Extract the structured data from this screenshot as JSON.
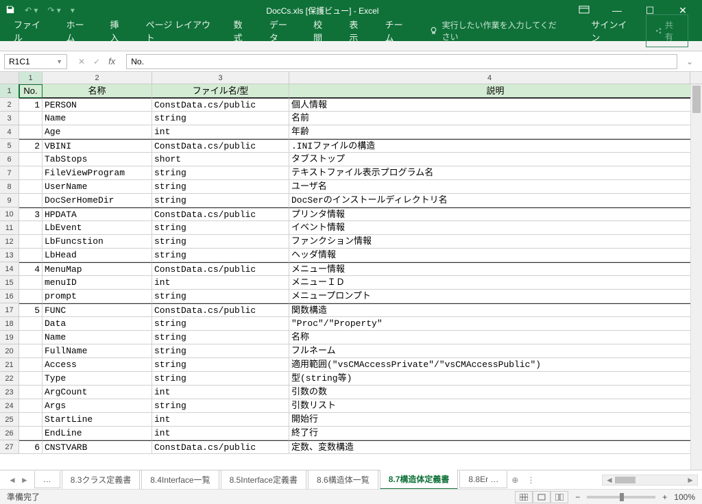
{
  "title": "DocCs.xls  [保護ビュー] - Excel",
  "qat": {
    "save": "save-icon",
    "undo": "undo-icon",
    "redo": "redo-icon"
  },
  "ribbon": {
    "tabs": [
      "ファイル",
      "ホーム",
      "挿入",
      "ページ レイアウト",
      "数式",
      "データ",
      "校閲",
      "表示",
      "チーム"
    ],
    "tellme": "実行したい作業を入力してください",
    "signin": "サインイン",
    "share": "共有"
  },
  "namebox": "R1C1",
  "formula": "No.",
  "colnums": [
    "1",
    "2",
    "3",
    "4"
  ],
  "headers": {
    "c1": "No.",
    "c2": "名称",
    "c3": "ファイル名/型",
    "c4": "説明"
  },
  "rows": [
    {
      "n": "1",
      "no": "1",
      "name": "PERSON",
      "type": "ConstData.cs/public",
      "desc": "個人情報"
    },
    {
      "n": "2",
      "no": "",
      "name": "Name",
      "type": "string",
      "desc": "名前"
    },
    {
      "n": "3",
      "no": "",
      "name": "Age",
      "type": "int",
      "desc": "年齢"
    },
    {
      "n": "4",
      "no": "2",
      "name": "VBINI",
      "type": "ConstData.cs/public",
      "desc": ".INIファイルの構造"
    },
    {
      "n": "5",
      "no": "",
      "name": "TabStops",
      "type": "short",
      "desc": "タブストップ"
    },
    {
      "n": "6",
      "no": "",
      "name": "FileViewProgram",
      "type": "string",
      "desc": "テキストファイル表示プログラム名"
    },
    {
      "n": "7",
      "no": "",
      "name": "UserName",
      "type": "string",
      "desc": "ユーザ名"
    },
    {
      "n": "8",
      "no": "",
      "name": "DocSerHomeDir",
      "type": "string",
      "desc": "DocSerのインストールディレクトリ名"
    },
    {
      "n": "9",
      "no": "3",
      "name": "HPDATA",
      "type": "ConstData.cs/public",
      "desc": "プリンタ情報"
    },
    {
      "n": "10",
      "no": "",
      "name": "LbEvent",
      "type": "string",
      "desc": "イベント情報"
    },
    {
      "n": "11",
      "no": "",
      "name": "LbFuncstion",
      "type": "string",
      "desc": "ファンクション情報"
    },
    {
      "n": "12",
      "no": "",
      "name": "LbHead",
      "type": "string",
      "desc": "ヘッダ情報"
    },
    {
      "n": "13",
      "no": "4",
      "name": "MenuMap",
      "type": "ConstData.cs/public",
      "desc": "メニュー情報"
    },
    {
      "n": "14",
      "no": "",
      "name": "menuID",
      "type": "int",
      "desc": "メニューＩＤ"
    },
    {
      "n": "15",
      "no": "",
      "name": "prompt",
      "type": "string",
      "desc": "メニュープロンプト"
    },
    {
      "n": "16",
      "no": "5",
      "name": "FUNC",
      "type": "ConstData.cs/public",
      "desc": "関数構造"
    },
    {
      "n": "17",
      "no": "",
      "name": "Data",
      "type": "string",
      "desc": "\"Proc\"/\"Property\""
    },
    {
      "n": "18",
      "no": "",
      "name": "Name",
      "type": "string",
      "desc": "名称"
    },
    {
      "n": "19",
      "no": "",
      "name": "FullName",
      "type": "string",
      "desc": "フルネーム"
    },
    {
      "n": "20",
      "no": "",
      "name": "Access",
      "type": "string",
      "desc": "適用範囲(\"vsCMAccessPrivate\"/\"vsCMAccessPublic\")"
    },
    {
      "n": "21",
      "no": "",
      "name": "Type",
      "type": "string",
      "desc": "型(string等)"
    },
    {
      "n": "22",
      "no": "",
      "name": "ArgCount",
      "type": "int",
      "desc": "引数の数"
    },
    {
      "n": "23",
      "no": "",
      "name": "Args",
      "type": "string",
      "desc": "引数リスト"
    },
    {
      "n": "24",
      "no": "",
      "name": "StartLine",
      "type": "int",
      "desc": "開始行"
    },
    {
      "n": "25",
      "no": "",
      "name": "EndLine",
      "type": "int",
      "desc": "終了行"
    },
    {
      "n": "26",
      "no": "6",
      "name": "CNSTVARB",
      "type": "ConstData.cs/public",
      "desc": "定数、変数構造"
    }
  ],
  "sheets": {
    "ellipsis": "…",
    "tabs": [
      {
        "label": "8.3クラス定義書",
        "active": false
      },
      {
        "label": "8.4Interface一覧",
        "active": false
      },
      {
        "label": "8.5Interface定義書",
        "active": false
      },
      {
        "label": "8.6構造体一覧",
        "active": false
      },
      {
        "label": "8.7構造体定義書",
        "active": true
      },
      {
        "label": "8.8Er …",
        "active": false
      }
    ]
  },
  "status": {
    "ready": "準備完了",
    "zoom": "100%"
  }
}
